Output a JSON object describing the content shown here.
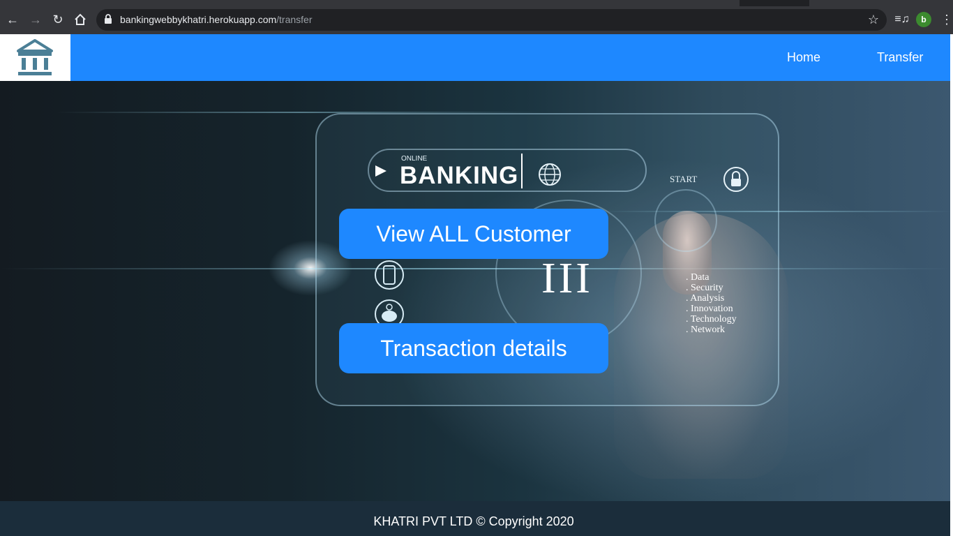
{
  "browser": {
    "url_host": "bankingwebbykhatri.herokuapp.com",
    "url_path": "/transfer",
    "profile_initial": "b",
    "icons": {
      "back": "arrow-left-icon",
      "forward": "arrow-right-icon",
      "reload": "reload-icon",
      "home": "home-icon",
      "lock": "lock-icon",
      "bookmark": "star-icon",
      "media": "media-queue-icon",
      "menu": "kebab-menu-icon"
    }
  },
  "navbar": {
    "logo_icon": "bank-building-icon",
    "links": [
      {
        "label": "Home"
      },
      {
        "label": "Transfer"
      }
    ],
    "color": "#1e88ff"
  },
  "hero": {
    "image_text": {
      "online": "ONLINE",
      "banking": "BANKING",
      "start": "START",
      "features": ". Data\n. Security\n. Analysis\n. Innovation\n. Technology\n. Network"
    },
    "buttons": [
      {
        "label": "View ALL Customer"
      },
      {
        "label": "Transaction details"
      }
    ]
  },
  "footer": {
    "text": "KHATRI PVT LTD © Copyright 2020"
  }
}
